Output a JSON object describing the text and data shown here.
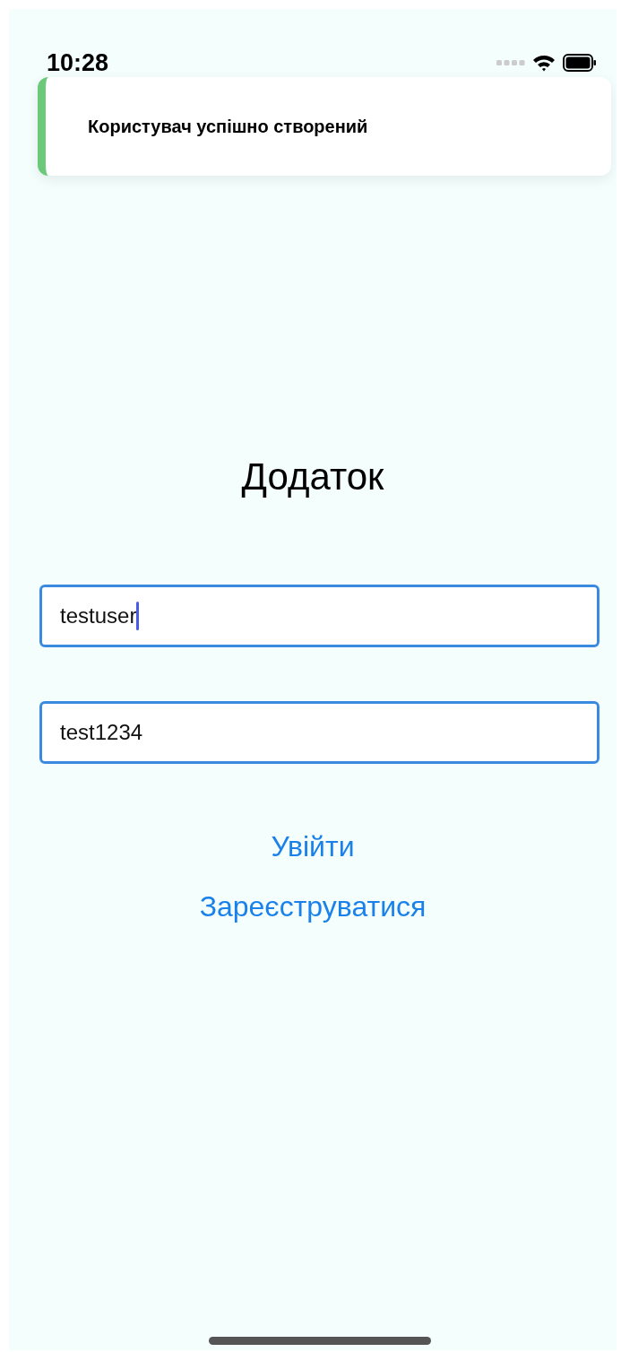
{
  "status_bar": {
    "time": "10:28"
  },
  "toast": {
    "message": "Користувач успішно створений",
    "color": "#6cc97a"
  },
  "title": "Додаток",
  "fields": [
    {
      "value": "testuser",
      "focused": true
    },
    {
      "value": "test1234",
      "focused": false
    }
  ],
  "buttons": [
    "Увійти",
    "Зареєструватися"
  ]
}
